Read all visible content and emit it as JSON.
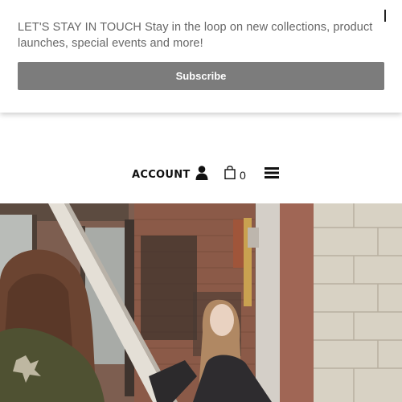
{
  "newsletter": {
    "text": "LET'S STAY IN TOUCH Stay in the loop on new collections, product launches, special events and more!",
    "subscribe_label": "Subscribe"
  },
  "header": {
    "account_label": "ACCOUNT",
    "cart_count": "0",
    "icons": [
      "user-icon",
      "shopping-bag-icon",
      "hamburger-menu-icon"
    ]
  },
  "hero": {
    "image": "photo-two-women-brick-wall"
  }
}
